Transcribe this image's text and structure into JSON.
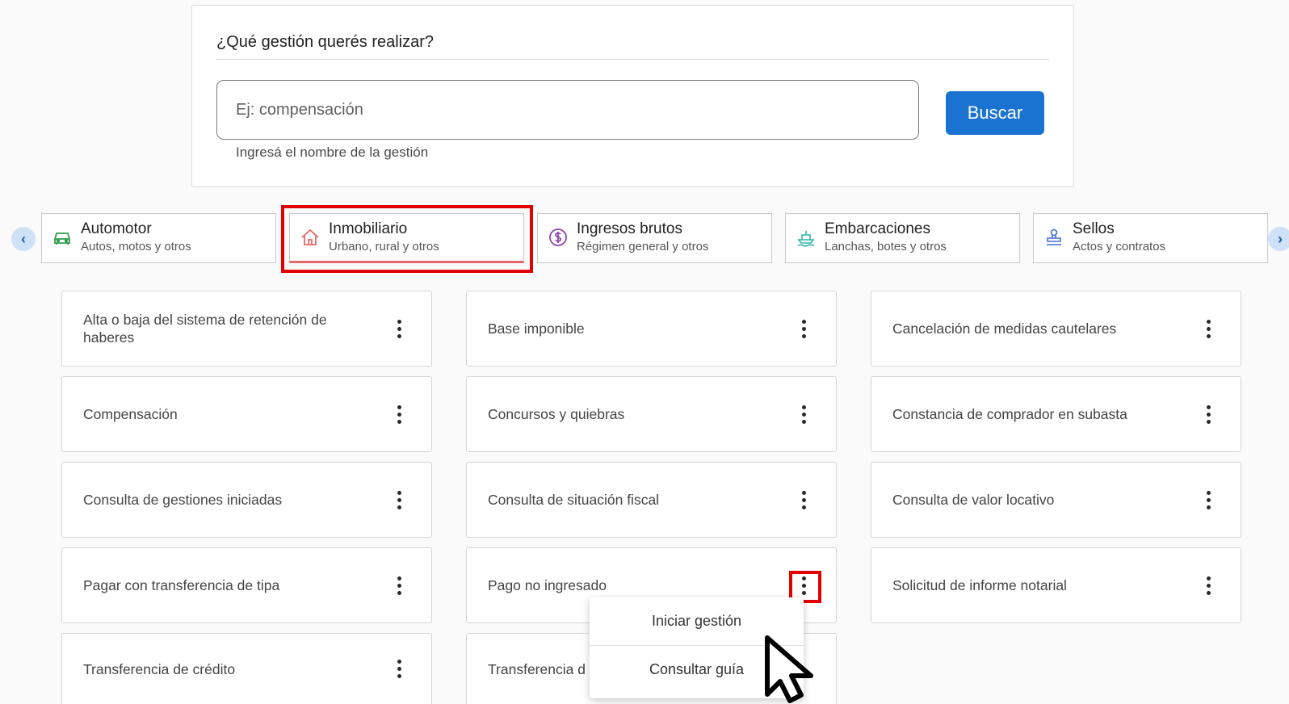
{
  "search": {
    "title": "¿Qué gestión querés realizar?",
    "placeholder": "Ej: compensación",
    "hint": "Ingresá el nombre de la gestión",
    "button_label": "Buscar"
  },
  "categories": [
    {
      "label": "Automotor",
      "sub": "Autos, motos y otros",
      "icon": "car-icon"
    },
    {
      "label": "Inmobiliario",
      "sub": "Urbano, rural y otros",
      "icon": "house-icon",
      "active": true,
      "accent": "#e46868"
    },
    {
      "label": "Ingresos brutos",
      "sub": "Régimen general y otros",
      "icon": "dollar-coin-icon",
      "accent": "#8e44ad"
    },
    {
      "label": "Embarcaciones",
      "sub": "Lanchas, botes y otros",
      "icon": "boat-icon",
      "accent": "#2bb5a8"
    },
    {
      "label": "Sellos",
      "sub": "Actos y contratos",
      "icon": "stamp-icon",
      "accent": "#3f6fd1"
    }
  ],
  "gestiones": [
    "Alta o baja del sistema de retención de haberes",
    "Base imponible",
    "Cancelación de medidas cautelares",
    "Compensación",
    "Concursos y quiebras",
    "Constancia de comprador en subasta",
    "Consulta de gestiones iniciadas",
    "Consulta de situación fiscal",
    "Consulta de valor locativo",
    "Pagar con transferencia de tipa",
    "Pago no ingresado",
    "Solicitud de informe notarial",
    "Transferencia de crédito",
    "Transferencia d"
  ],
  "menu": {
    "items": [
      "Iniciar gestión",
      "Consultar guía"
    ]
  },
  "colors": {
    "primary": "#1a73d1",
    "highlight": "#e30000"
  }
}
